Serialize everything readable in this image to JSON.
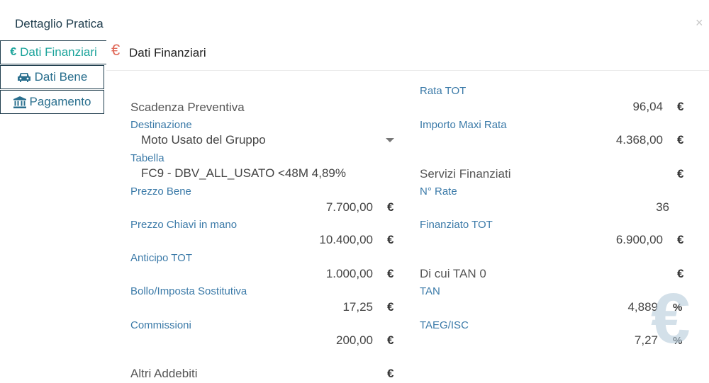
{
  "header": {
    "title": "Dettaglio Pratica"
  },
  "tabs": [
    {
      "label": "Dati Finanziari",
      "icon": "euro-icon"
    },
    {
      "label": "Dati Bene",
      "icon": "car-icon"
    },
    {
      "label": "Pagamento",
      "icon": "bank-icon"
    }
  ],
  "section": {
    "icon": "€",
    "title": "Dati Finanziari"
  },
  "left": {
    "scadenza_label": "Scadenza Preventiva",
    "destinazione_label": "Destinazione",
    "destinazione_value": "Moto Usato del Gruppo",
    "tabella_label": "Tabella",
    "tabella_value": "FC9 - DBV_ALL_USATO <48M 4,89%",
    "prezzo_bene_label": "Prezzo Bene",
    "prezzo_bene_value": "7.700,00",
    "prezzo_chiavi_label": "Prezzo Chiavi in mano",
    "prezzo_chiavi_value": "10.400,00",
    "anticipo_label": "Anticipo TOT",
    "anticipo_value": "1.000,00",
    "bollo_label": "Bollo/Imposta Sostitutiva",
    "bollo_value": "17,25",
    "commissioni_label": "Commissioni",
    "commissioni_value": "200,00",
    "altri_label": "Altri Addebiti"
  },
  "right": {
    "rata_label": "Rata TOT",
    "rata_value": "96,04",
    "maxi_label": "Importo Maxi Rata",
    "maxi_value": "4.368,00",
    "servizi_label": "Servizi Finanziati",
    "nrate_label": "N° Rate",
    "nrate_value": "36",
    "finanziato_label": "Finanziato TOT",
    "finanziato_value": "6.900,00",
    "tan0_label": "Di cui TAN 0",
    "tan_label": "TAN",
    "tan_value": "4,889",
    "taeg_label": "TAEG/ISC",
    "taeg_value": "7,27"
  },
  "symbols": {
    "euro": "€",
    "percent": "%",
    "close": "×"
  },
  "colors": {
    "accent_teal": "#1aa39a",
    "label_blue": "#3b7aa8",
    "euro_red": "#e06a5a",
    "dark_navy": "#1f3d4d"
  }
}
